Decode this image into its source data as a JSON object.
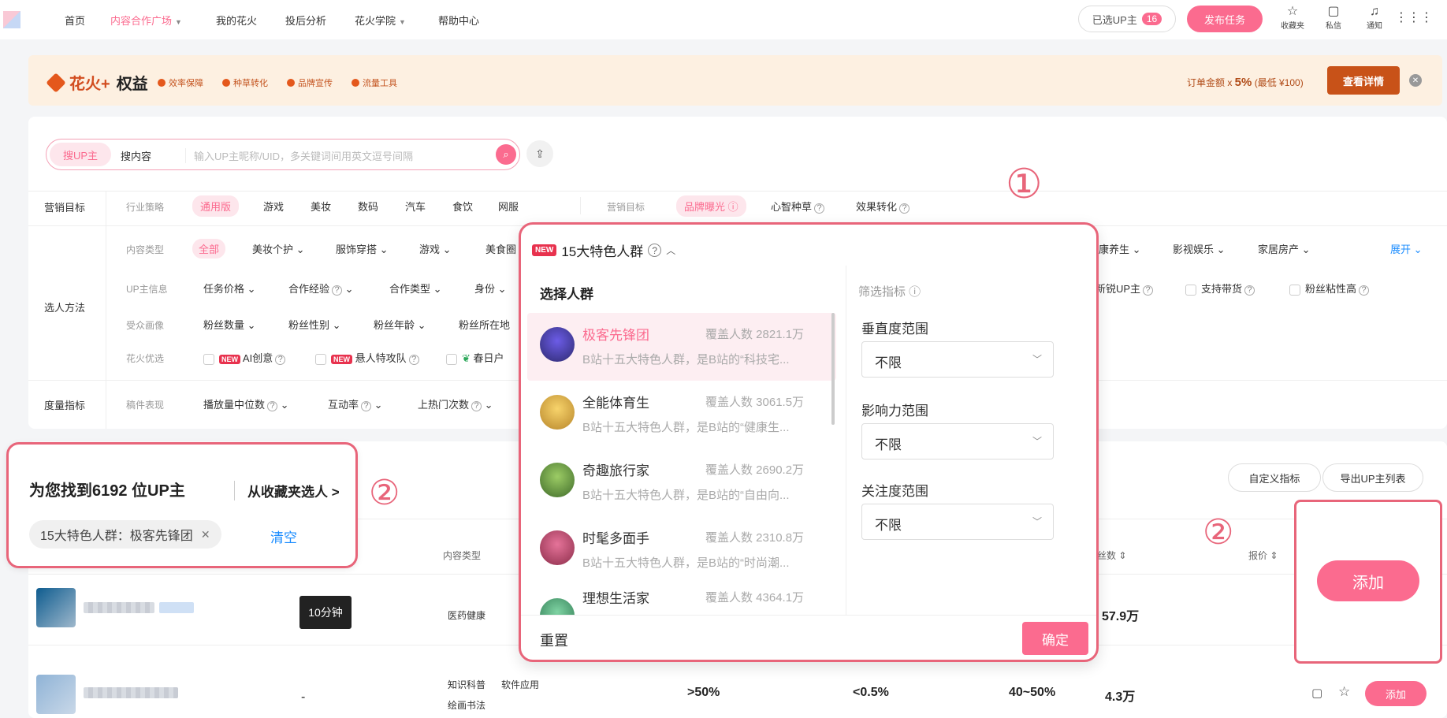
{
  "nav": {
    "items": [
      "首页",
      "内容合作广场",
      "我的花火",
      "投后分析",
      "花火学院",
      "帮助中心"
    ],
    "selected_up_label": "已选UP主",
    "selected_up_count": "16",
    "publish_button": "发布任务",
    "favorites": "收藏夹",
    "messages": "私信",
    "notifications": "通知"
  },
  "banner": {
    "brand": "花火+",
    "title": "权益",
    "tags": [
      "效率保障",
      "种草转化",
      "品牌宣传",
      "流量工具"
    ],
    "right_prefix": "订单金额 x ",
    "right_pct": "5%",
    "right_suffix": " (最低 ¥100)",
    "button": "查看详情"
  },
  "search": {
    "tab_up": "搜UP主",
    "tab_content": "搜内容",
    "placeholder": "输入UP主昵称/UID，多关键词间用英文逗号间隔"
  },
  "filters": {
    "marketing_goal_label": "营销目标",
    "industry_label": "行业策略",
    "industry_items": [
      "通用版",
      "游戏",
      "美妆",
      "数码",
      "汽车",
      "食饮",
      "网服"
    ],
    "goal_sub_label": "营销目标",
    "goal_items": [
      "品牌曝光",
      "心智种草",
      "效果转化"
    ],
    "select_method_label": "选人方法",
    "content_type_label": "内容类型",
    "content_type_items": [
      "全部",
      "美妆个护",
      "服饰穿搭",
      "游戏",
      "美食圈"
    ],
    "content_type_right_items": [
      "康养生",
      "影视娱乐",
      "家居房产"
    ],
    "expand": "展开",
    "up_info_label": "UP主信息",
    "up_info_items": [
      "任务价格",
      "合作经验",
      "合作类型",
      "身份"
    ],
    "up_info_right_items": [
      "新锐UP主",
      "支持带货",
      "粉丝粘性高"
    ],
    "audience_label": "受众画像",
    "audience_items": [
      "粉丝数量",
      "粉丝性别",
      "粉丝年龄",
      "粉丝所在地"
    ],
    "huahuo_label": "花火优选",
    "huahuo_items": [
      "AI创意",
      "悬人特攻队",
      "春日户"
    ],
    "metrics_label": "度量指标",
    "manuscript_label": "稿件表现",
    "metric_items": [
      "播放量中位数",
      "互动率",
      "上热门次数"
    ]
  },
  "popup": {
    "header": "15大特色人群",
    "new_tag": "NEW",
    "left_title": "选择人群",
    "groups": [
      {
        "name": "极客先锋团",
        "coverage": "覆盖人数 2821.1万",
        "desc": "B站十五大特色人群，是B站的“科技宅..."
      },
      {
        "name": "全能体育生",
        "coverage": "覆盖人数 3061.5万",
        "desc": "B站十五大特色人群，是B站的“健康生..."
      },
      {
        "name": "奇趣旅行家",
        "coverage": "覆盖人数 2690.2万",
        "desc": "B站十五大特色人群，是B站的“自由向..."
      },
      {
        "name": "时髦多面手",
        "coverage": "覆盖人数 2310.8万",
        "desc": "B站十五大特色人群，是B站的“时尚潮..."
      },
      {
        "name": "理想生活家",
        "coverage": "覆盖人数 4364.1万",
        "desc": ""
      }
    ],
    "indicator_title": "筛选指标",
    "vertical_label": "垂直度范围",
    "influence_label": "影响力范围",
    "attention_label": "关注度范围",
    "select_value": "不限",
    "reset": "重置",
    "confirm": "确定",
    "annotation": "①"
  },
  "results": {
    "found_text": "为您找到6192 位UP主",
    "from_favorites": "从收藏夹选人 >",
    "active_filter": "15大特色人群：极客先锋团",
    "clear": "清空",
    "annotation": "②",
    "custom_metric": "自定义指标",
    "export": "导出UP主列表",
    "col_content_type": "内容类型",
    "col_fans": "丝数 ⇕",
    "col_price": "报价 ⇕",
    "add_big": "添加",
    "row1": {
      "duration": "10分钟",
      "type": "医药健康",
      "fans": "57.9万"
    },
    "row2": {
      "dash": "-",
      "type1": "知识科普",
      "type2": "软件应用",
      "type3": "绘画书法",
      "c1": ">50%",
      "c2": "<0.5%",
      "c3": "40~50%",
      "fans": "4.3万",
      "add": "添加"
    }
  },
  "colors": {
    "accent": "#fb6b8f",
    "annotation": "#e8657a",
    "banner": "#fdf0e1"
  }
}
